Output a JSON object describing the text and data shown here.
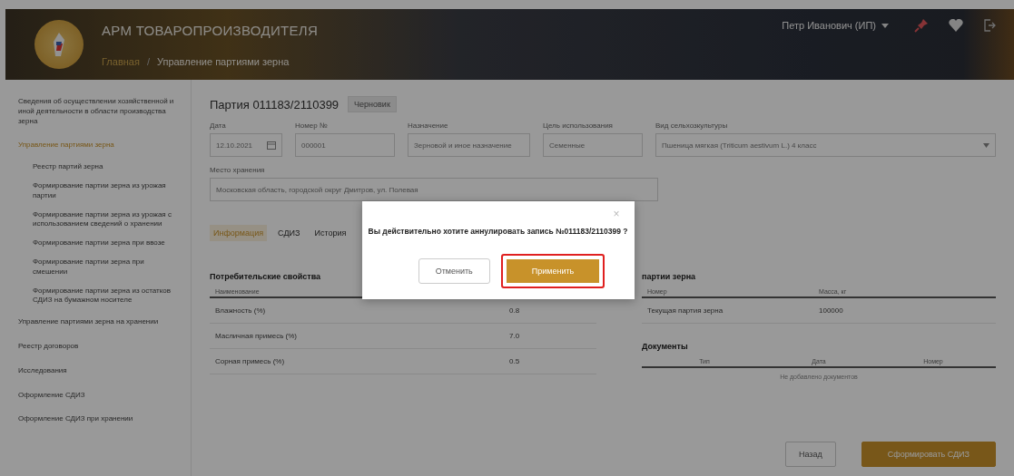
{
  "header": {
    "title": "АРМ ТОВАРОПРОИЗВОДИТЕЛЯ",
    "breadcrumb_separator": "/",
    "breadcrumbs": [
      {
        "label": "Главная",
        "current": false
      },
      {
        "label": "Управление партиями зерна",
        "current": true
      }
    ],
    "user": "Петр Иванович (ИП)"
  },
  "sidebar": {
    "items": [
      {
        "label": "Сведения об осуществлении хозяйственной и иной деятельности в области производства зерна",
        "selected": false
      },
      {
        "label": "Управление партиями зерна",
        "selected": true,
        "children": [
          {
            "label": "Реестр партий зерна",
            "selected": false
          },
          {
            "label": "Формирование партии зерна из урожая партии",
            "selected": false
          },
          {
            "label": "Формирование партии зерна из урожая с использованием сведений о хранении",
            "selected": false
          },
          {
            "label": "Формирование партии зерна при ввозе",
            "selected": false
          },
          {
            "label": "Формирование партии зерна при смешении",
            "selected": false
          },
          {
            "label": "Формирование партии зерна из остатков СДИЗ на бумажном носителе",
            "selected": false
          }
        ]
      },
      {
        "label": "Управление партиями зерна на хранении",
        "selected": false
      },
      {
        "label": "Реестр договоров",
        "selected": false
      },
      {
        "label": "Исследования",
        "selected": false
      },
      {
        "label": "Оформление СДИЗ",
        "selected": false
      },
      {
        "label": "Оформление СДИЗ при хранении",
        "selected": false
      }
    ]
  },
  "batch": {
    "title": "Партия 011183/2110399",
    "status": "Черновик"
  },
  "fields": [
    {
      "label": "Дата",
      "value": "12.10.2021",
      "kind": "date"
    },
    {
      "label": "Номер №",
      "value": "000001",
      "kind": "text"
    },
    {
      "label": "Назначение",
      "value": "Зерновой и иное назначение",
      "kind": "text"
    },
    {
      "label": "Цель использования",
      "value": "Семенные",
      "kind": "text"
    },
    {
      "label": "Вид сельхозкультуры",
      "value": "Пшеница мягкая (Triticum aestivum L.) 4 класс",
      "kind": "select"
    }
  ],
  "storage_field": {
    "label": "Место хранения",
    "value": "Московская область, городской округ Дмитров, ул. Полевая"
  },
  "tabs": [
    {
      "label": "Информация",
      "selected": true
    },
    {
      "label": "СДИЗ",
      "selected": false
    },
    {
      "label": "История",
      "selected": false
    }
  ],
  "properties": {
    "title": "Потребительские свойства",
    "columns": [
      "Наименование",
      null
    ],
    "rows": [
      [
        "Влажность (%)",
        "0.8"
      ],
      [
        "Масличная примесь (%)",
        "7.0"
      ],
      [
        "Сорная примесь (%)",
        "0.5"
      ]
    ]
  },
  "composition": {
    "title": "партии зерна",
    "columns": [
      "Номер",
      "Масса, кг"
    ],
    "rows": [
      [
        "Текущая партия зерна",
        "100000"
      ]
    ]
  },
  "documents": {
    "title": "Документы",
    "columns": [
      "Тип",
      "Дата",
      "Номер"
    ],
    "empty": "Не добавлено документов"
  },
  "footer_buttons": [
    {
      "label": "Назад",
      "kind": "secondary"
    },
    {
      "label": "Сформировать СДИЗ",
      "kind": "primary"
    }
  ],
  "dialog": {
    "close": "×",
    "message": "Вы действительно хотите аннулировать запись №011183/2110399 ?",
    "buttons": [
      {
        "label": "Отменить",
        "kind": "secondary",
        "highlighted": false
      },
      {
        "label": "Применить",
        "kind": "primary",
        "highlighted": true
      }
    ]
  }
}
